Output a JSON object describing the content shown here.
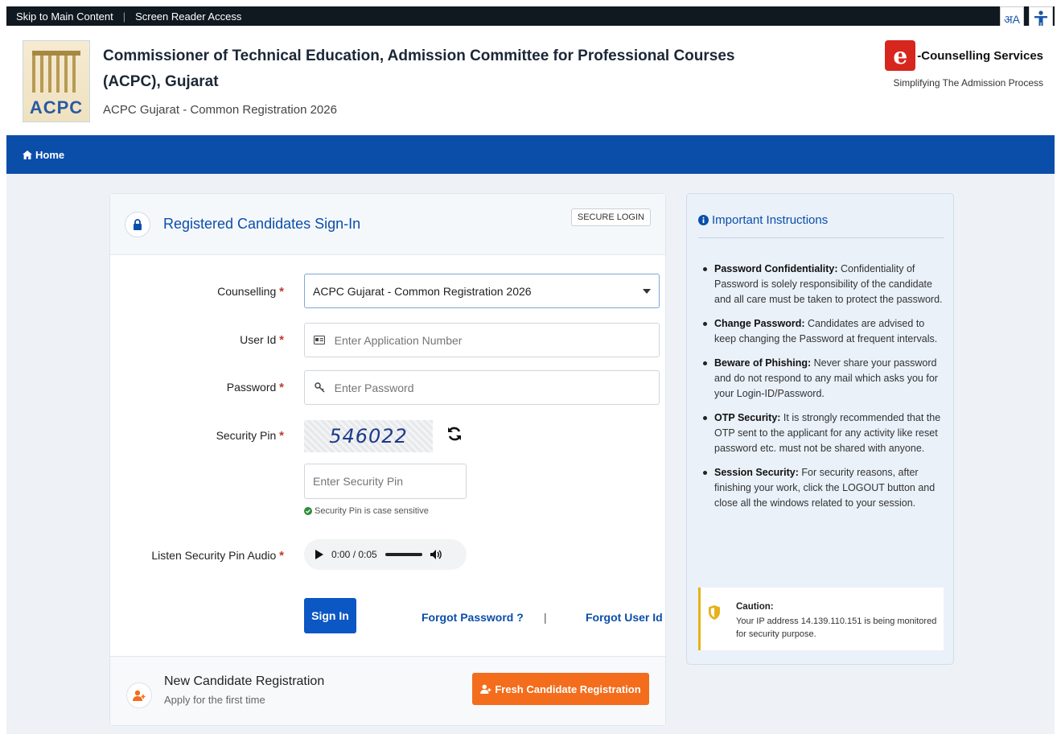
{
  "topbar": {
    "skip": "Skip to Main Content",
    "sep": "|",
    "reader": "Screen Reader Access",
    "lang_glyph": "अA",
    "a11y_glyph": "♿"
  },
  "header": {
    "logo_text": "ACPC",
    "title": "Commissioner of Technical Education, Admission Committee for Professional Courses (ACPC), Gujarat",
    "subtitle": "ACPC Gujarat - Common Registration 2026",
    "ecs_letter": "e",
    "ecs_brand": "-Counselling Services",
    "ecs_tagline": "Simplifying The Admission Process"
  },
  "nav": {
    "home": "Home"
  },
  "login": {
    "title": "Registered Candidates Sign-In",
    "secure_badge": "SECURE LOGIN",
    "counselling_label": "Counselling",
    "counselling_value": "ACPC Gujarat - Common Registration 2026",
    "userid_label": "User Id",
    "userid_placeholder": "Enter Application Number",
    "password_label": "Password",
    "password_placeholder": "Enter Password",
    "pin_label": "Security Pin",
    "captcha_text": "546022",
    "pin_placeholder": "Enter Security Pin",
    "pin_note": "Security Pin is case sensitive",
    "audio_label": "Listen Security Pin Audio",
    "audio_time": "0:00 / 0:05",
    "required": "*",
    "signin": "Sign In",
    "forgot_password": "Forgot Password ?",
    "pipe": "|",
    "forgot_userid": "Forgot User Id"
  },
  "newreg": {
    "title": "New Candidate Registration",
    "subtitle": "Apply for the first time",
    "button": "Fresh Candidate Registration"
  },
  "instructions": {
    "title": "Important Instructions",
    "items": [
      {
        "head": "Password Confidentiality:",
        "body": " Confidentiality of Password is solely responsibility of the candidate and all care must be taken to protect the password."
      },
      {
        "head": "Change Password:",
        "body": " Candidates are advised to keep changing the Password at frequent intervals."
      },
      {
        "head": "Beware of Phishing:",
        "body": " Never share your password and do not respond to any mail which asks you for your Login-ID/Password."
      },
      {
        "head": "OTP Security:",
        "body": " It is strongly recommended that the OTP sent to the applicant for any activity like reset password etc. must not be shared with anyone."
      },
      {
        "head": "Session Security:",
        "body": " For security reasons, after finishing your work, click the LOGOUT button and close all the windows related to your session."
      }
    ],
    "caution_title": "Caution:",
    "caution_body": "Your IP address 14.139.110.151 is being monitored for security purpose."
  },
  "colors": {
    "brand_blue": "#0b4eaa",
    "nav_blue": "#0b4eaa",
    "orange": "#f36d1c",
    "caution": "#e6b21a"
  }
}
